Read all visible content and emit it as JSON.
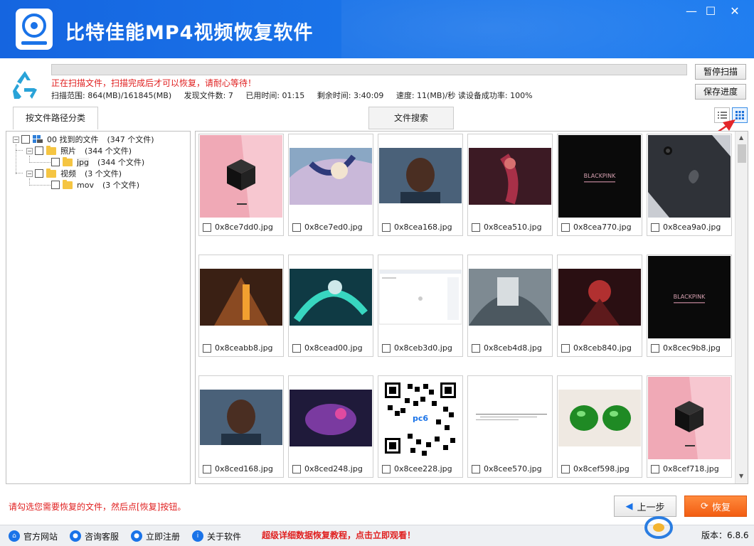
{
  "app": {
    "title": "比特佳能MP4视频恢复软件"
  },
  "window": {
    "minimize": "—",
    "maximize": "☐",
    "close": "✕"
  },
  "scan": {
    "warning": "正在扫描文件，扫描完成后才可以恢复，请耐心等待！",
    "range": "扫描范围: 864(MB)/161845(MB)",
    "found": "发现文件数: 7",
    "elapsed": "已用时间: 01:15",
    "remaining": "剩余时间: 3:40:09",
    "speed": "速度: 11(MB)/秒 读设备成功率: 100%",
    "pause_label": "暂停扫描",
    "save_label": "保存进度"
  },
  "tabs": {
    "by_path": "按文件路径分类",
    "search": "文件搜索"
  },
  "tree": {
    "root_name": "00 找到的文件",
    "root_count": "(347 个文件)",
    "photos_name": "照片",
    "photos_count": "(344 个文件)",
    "jpg_name": "jpg",
    "jpg_count": "(344 个文件)",
    "videos_name": "视频",
    "videos_count": "(3 个文件)",
    "mov_name": "mov",
    "mov_count": "(3 个文件)"
  },
  "files": [
    {
      "name": "0x8ce7dd0.jpg",
      "type": "pink-cube"
    },
    {
      "name": "0x8ce7ed0.jpg",
      "type": "art-light"
    },
    {
      "name": "0x8cea168.jpg",
      "type": "portrait"
    },
    {
      "name": "0x8cea510.jpg",
      "type": "art-dark"
    },
    {
      "name": "0x8cea770.jpg",
      "type": "black-logo"
    },
    {
      "name": "0x8cea9a0.jpg",
      "type": "phone"
    },
    {
      "name": "0x8ceabb8.jpg",
      "type": "art-fire"
    },
    {
      "name": "0x8cead00.jpg",
      "type": "art-teal"
    },
    {
      "name": "0x8ceb3d0.jpg",
      "type": "screenshot"
    },
    {
      "name": "0x8ceb4d8.jpg",
      "type": "art-grey"
    },
    {
      "name": "0x8ceb840.jpg",
      "type": "art-red"
    },
    {
      "name": "0x8cec9b8.jpg",
      "type": "black-logo"
    },
    {
      "name": "0x8ced168.jpg",
      "type": "portrait"
    },
    {
      "name": "0x8ced248.jpg",
      "type": "art-purple"
    },
    {
      "name": "0x8cee228.jpg",
      "type": "qr"
    },
    {
      "name": "0x8cee570.jpg",
      "type": "document"
    },
    {
      "name": "0x8cef598.jpg",
      "type": "green-gems"
    },
    {
      "name": "0x8cef718.jpg",
      "type": "pink-cube"
    }
  ],
  "thumb_text": {
    "brand_logo": "BLACKPINK",
    "qr_logo": "pc6"
  },
  "bottom": {
    "hint": "请勾选您需要恢复的文件，然后点[恢复]按钮。",
    "back_label": "上一步",
    "recover_label": "恢复"
  },
  "statusbar": {
    "website": "官方网站",
    "support": "咨询客服",
    "register": "立即注册",
    "about": "关于软件",
    "tutorial": "超级详细数据恢复教程，点击立即观看！",
    "version": "版本：6.8.6"
  },
  "colors": {
    "title_bg": "#1a73e8",
    "accent_orange": "#f25d12",
    "warning_red": "#e02020"
  }
}
